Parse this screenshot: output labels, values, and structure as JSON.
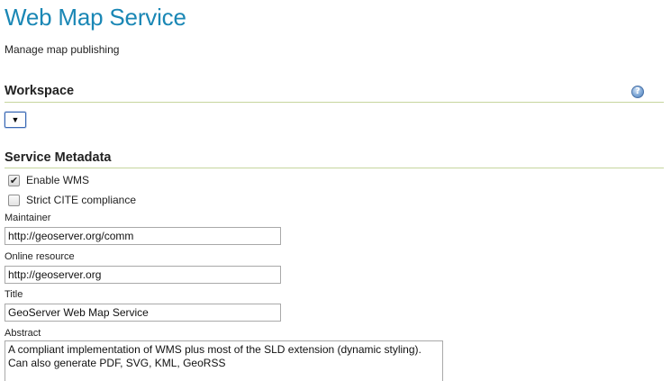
{
  "header": {
    "title": "Web Map Service",
    "description": "Manage map publishing"
  },
  "workspace": {
    "heading": "Workspace",
    "help_icon": "help-icon",
    "select_arrow": "▼"
  },
  "service_metadata": {
    "heading": "Service Metadata",
    "enable_wms": {
      "label": "Enable WMS",
      "checked": true,
      "mark": "✔"
    },
    "strict_cite": {
      "label": "Strict CITE compliance",
      "checked": false,
      "mark": ""
    },
    "maintainer": {
      "label": "Maintainer",
      "value": "http://geoserver.org/comm"
    },
    "online_resource": {
      "label": "Online resource",
      "value": "http://geoserver.org"
    },
    "title": {
      "label": "Title",
      "value": "GeoServer Web Map Service"
    },
    "abstract": {
      "label": "Abstract",
      "value": "A compliant implementation of WMS plus most of the SLD extension (dynamic styling).\nCan also generate PDF, SVG, KML, GeoRSS"
    }
  }
}
